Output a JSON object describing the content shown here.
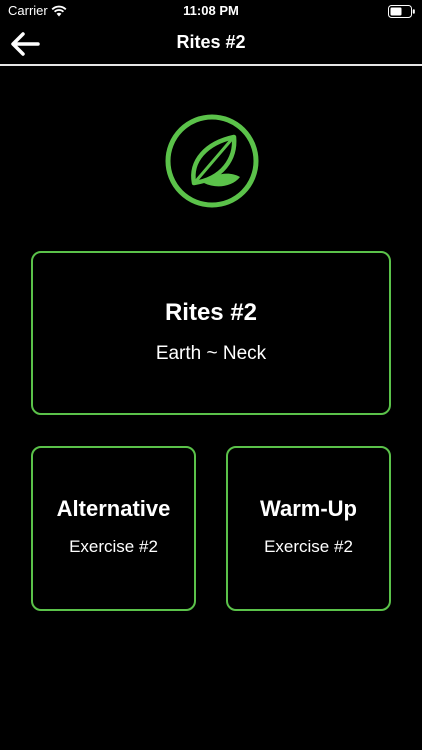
{
  "status_bar": {
    "carrier": "Carrier",
    "time": "11:08 PM"
  },
  "nav": {
    "title": "Rites #2",
    "back_icon": "arrow-left-icon"
  },
  "logo": {
    "icon": "leaf-circle-logo",
    "color": "#5bc24a"
  },
  "main_card": {
    "title": "Rites #2",
    "subtitle": "Earth ~ Neck"
  },
  "cards": [
    {
      "title": "Alternative",
      "subtitle": "Exercise #2"
    },
    {
      "title": "Warm-Up",
      "subtitle": "Exercise #2"
    }
  ],
  "colors": {
    "background": "#000000",
    "accent": "#5bc24a",
    "text": "#ffffff"
  }
}
